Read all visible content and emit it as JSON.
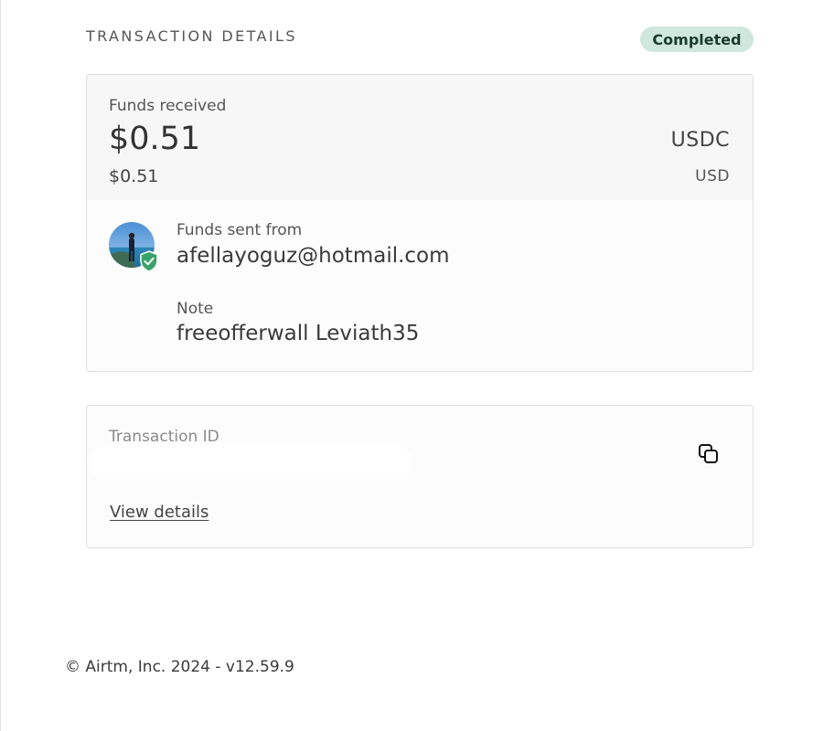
{
  "header": {
    "title": "TRANSACTION DETAILS",
    "status": "Completed"
  },
  "funds": {
    "label": "Funds received",
    "amount": "$0.51",
    "currency": "USDC",
    "amount_converted": "$0.51",
    "currency_converted": "USD"
  },
  "sender": {
    "label": "Funds sent from",
    "email": "afellayoguz@hotmail.com",
    "note_label": "Note",
    "note": "freeofferwall Leviath35"
  },
  "transaction": {
    "id_label": "Transaction ID",
    "view_details": "View details"
  },
  "footer": {
    "text": "© Airtm, Inc. 2024 - v12.59.9"
  },
  "colors": {
    "badge_bg": "#cfe7dd",
    "badge_text": "#1d3a2e",
    "verified_shield": "#3aa36b"
  },
  "icons": [
    "user-avatar",
    "verified-shield-icon",
    "copy-icon"
  ]
}
